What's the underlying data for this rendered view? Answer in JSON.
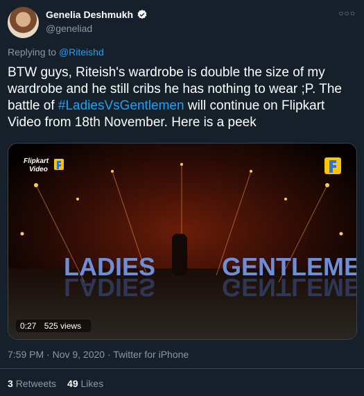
{
  "author": {
    "display_name": "Genelia Deshmukh",
    "handle": "@geneliad",
    "verified_icon": "verified-icon",
    "more_icon": "more-icon"
  },
  "reply": {
    "prefix": "Replying to",
    "to": "@Riteishd"
  },
  "tweet": {
    "text_part1": "BTW guys, Riteish's wardrobe is double the size of my wardrobe and he still cribs he has nothing to wear ;P. The battle of ",
    "hashtag": "#LadiesVsGentlemen",
    "text_part2": " will continue on Flipkart Video from 18th November. Here is a peek"
  },
  "video": {
    "brand_line1": "Flipkart",
    "brand_line2": "Video",
    "word_left": "LADIES",
    "word_right": "GENTLEMEN",
    "duration": "0:27",
    "views": "525 views"
  },
  "meta": {
    "timestamp": "7:59 PM · Nov 9, 2020 · Twitter for iPhone"
  },
  "stats": {
    "retweets_count": "3",
    "retweets_label": "Retweets",
    "likes_count": "49",
    "likes_label": "Likes"
  },
  "colors": {
    "background": "#15202b",
    "link": "#1da1f2",
    "muted": "#8899a6"
  }
}
